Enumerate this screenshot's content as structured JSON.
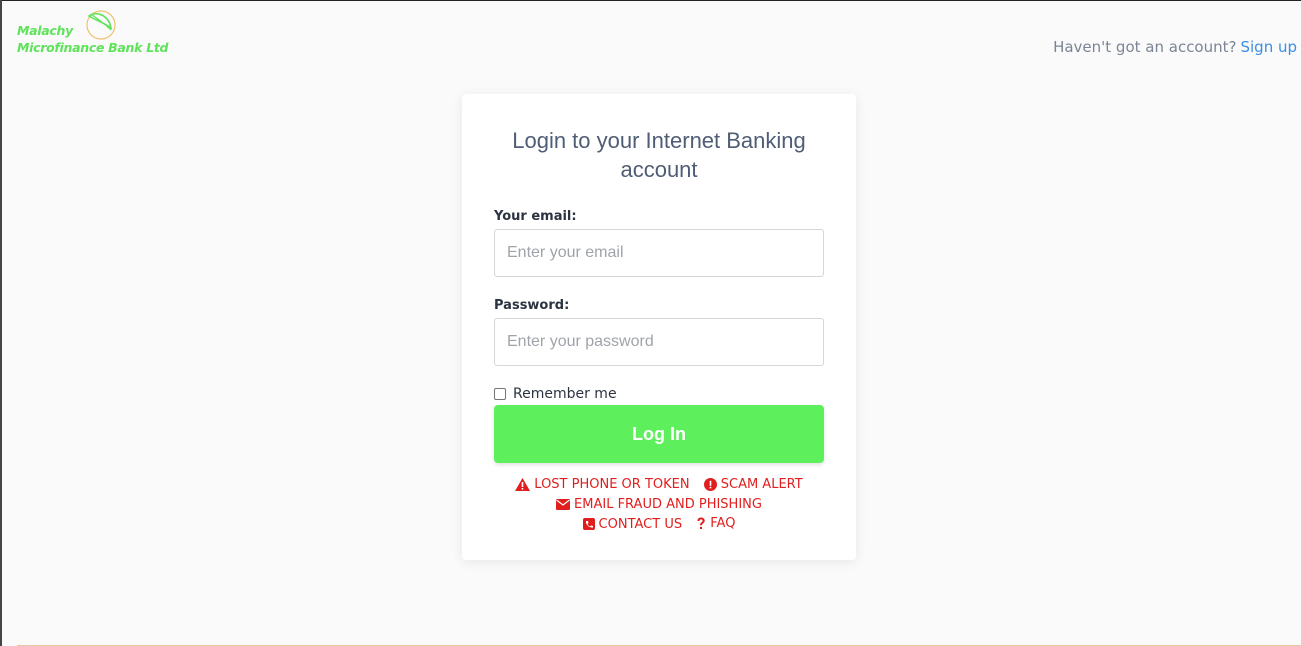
{
  "brand": {
    "line1": "Malachy",
    "line2": "Microfinance Bank Ltd"
  },
  "header": {
    "signup_prompt": "Haven't got an account?",
    "signup_link": "Sign up"
  },
  "login": {
    "title": "Login to your Internet Banking account",
    "email_label": "Your email:",
    "email_placeholder": "Enter your email",
    "password_label": "Password:",
    "password_placeholder": "Enter your password",
    "remember_label": "Remember me",
    "submit_label": "Log In"
  },
  "help_links": {
    "lost_phone": "LOST PHONE OR TOKEN",
    "scam_alert": "SCAM ALERT",
    "email_fraud": "EMAIL FRAUD AND PHISHING",
    "contact": "CONTACT US",
    "faq": "FAQ"
  },
  "colors": {
    "brand_green": "#5ee35a",
    "button_green": "#5ef05c",
    "link_blue": "#3a8ee6",
    "alert_red": "#e01e1e"
  },
  "icons": [
    "warning-triangle-icon",
    "exclamation-circle-icon",
    "envelope-icon",
    "phone-square-icon",
    "question-icon"
  ]
}
